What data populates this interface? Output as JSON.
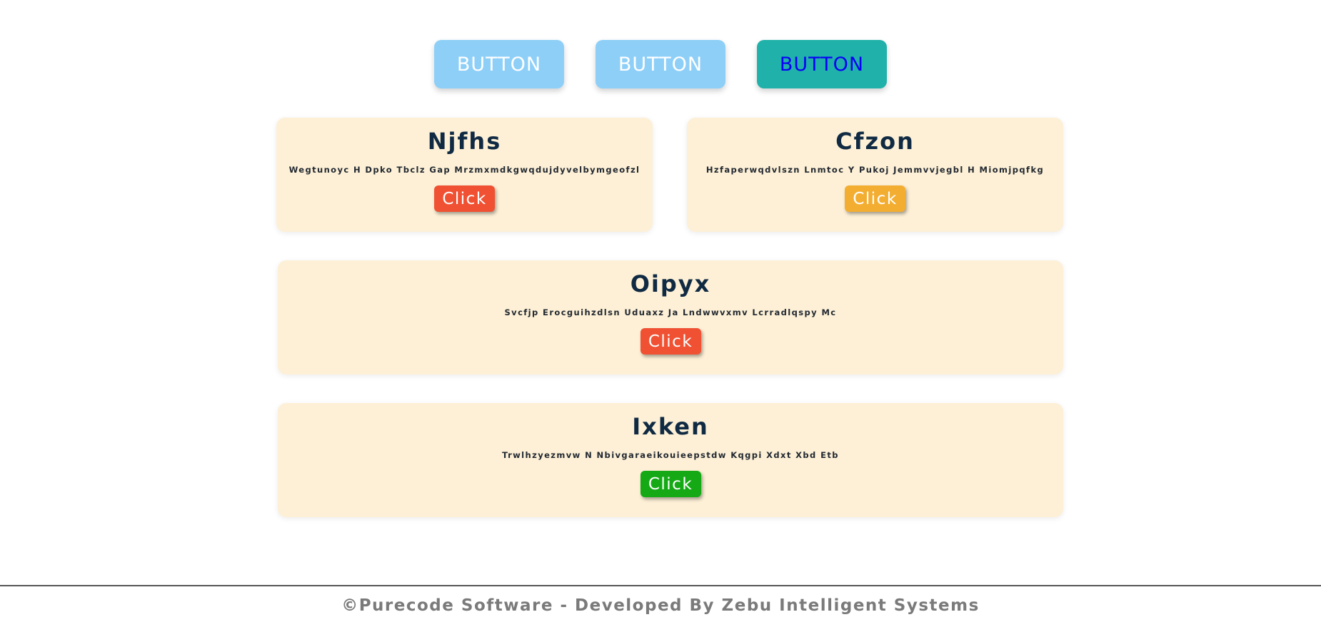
{
  "top_buttons": [
    {
      "label": "BUTTON",
      "style": "light"
    },
    {
      "label": "BUTTON",
      "style": "light"
    },
    {
      "label": "BUTTON",
      "style": "teal"
    }
  ],
  "cards": [
    {
      "title": "Njfhs",
      "description": "Wegtunoyc H Dpko Tbclz Gap Mrzmxmdkgwqdujdyvelbymgeofzl",
      "button_label": "Click",
      "button_color": "#f05133"
    },
    {
      "title": "Cfzon",
      "description": "Hzfaperwqdvlszn Lnmtoc Y Pukoj Jemmvvjegbl H Miomjpqfkg",
      "button_label": "Click",
      "button_color": "#f3ae32"
    },
    {
      "title": "Oipyx",
      "description": "Svcfjp Erocguihzdlsn Uduaxz Ja Lndwwvxmv Lcrradlqspy Mc",
      "button_label": "Click",
      "button_color": "#f05133"
    },
    {
      "title": "Ixken",
      "description": "Trwlhzyezmvw N Nbivgaraeikouieepstdw Kqgpi Xdxt Xbd Etb",
      "button_label": "Click",
      "button_color": "#15a915"
    }
  ],
  "footer": {
    "text": "©Purecode Software - Developed By Zebu Intelligent Systems"
  },
  "colors": {
    "card_bg": "#fdf0d6",
    "title": "#102a43",
    "top_button_light": "#8ecff8",
    "top_button_teal": "#20b2aa",
    "top_button_teal_text": "#0a00f5"
  }
}
